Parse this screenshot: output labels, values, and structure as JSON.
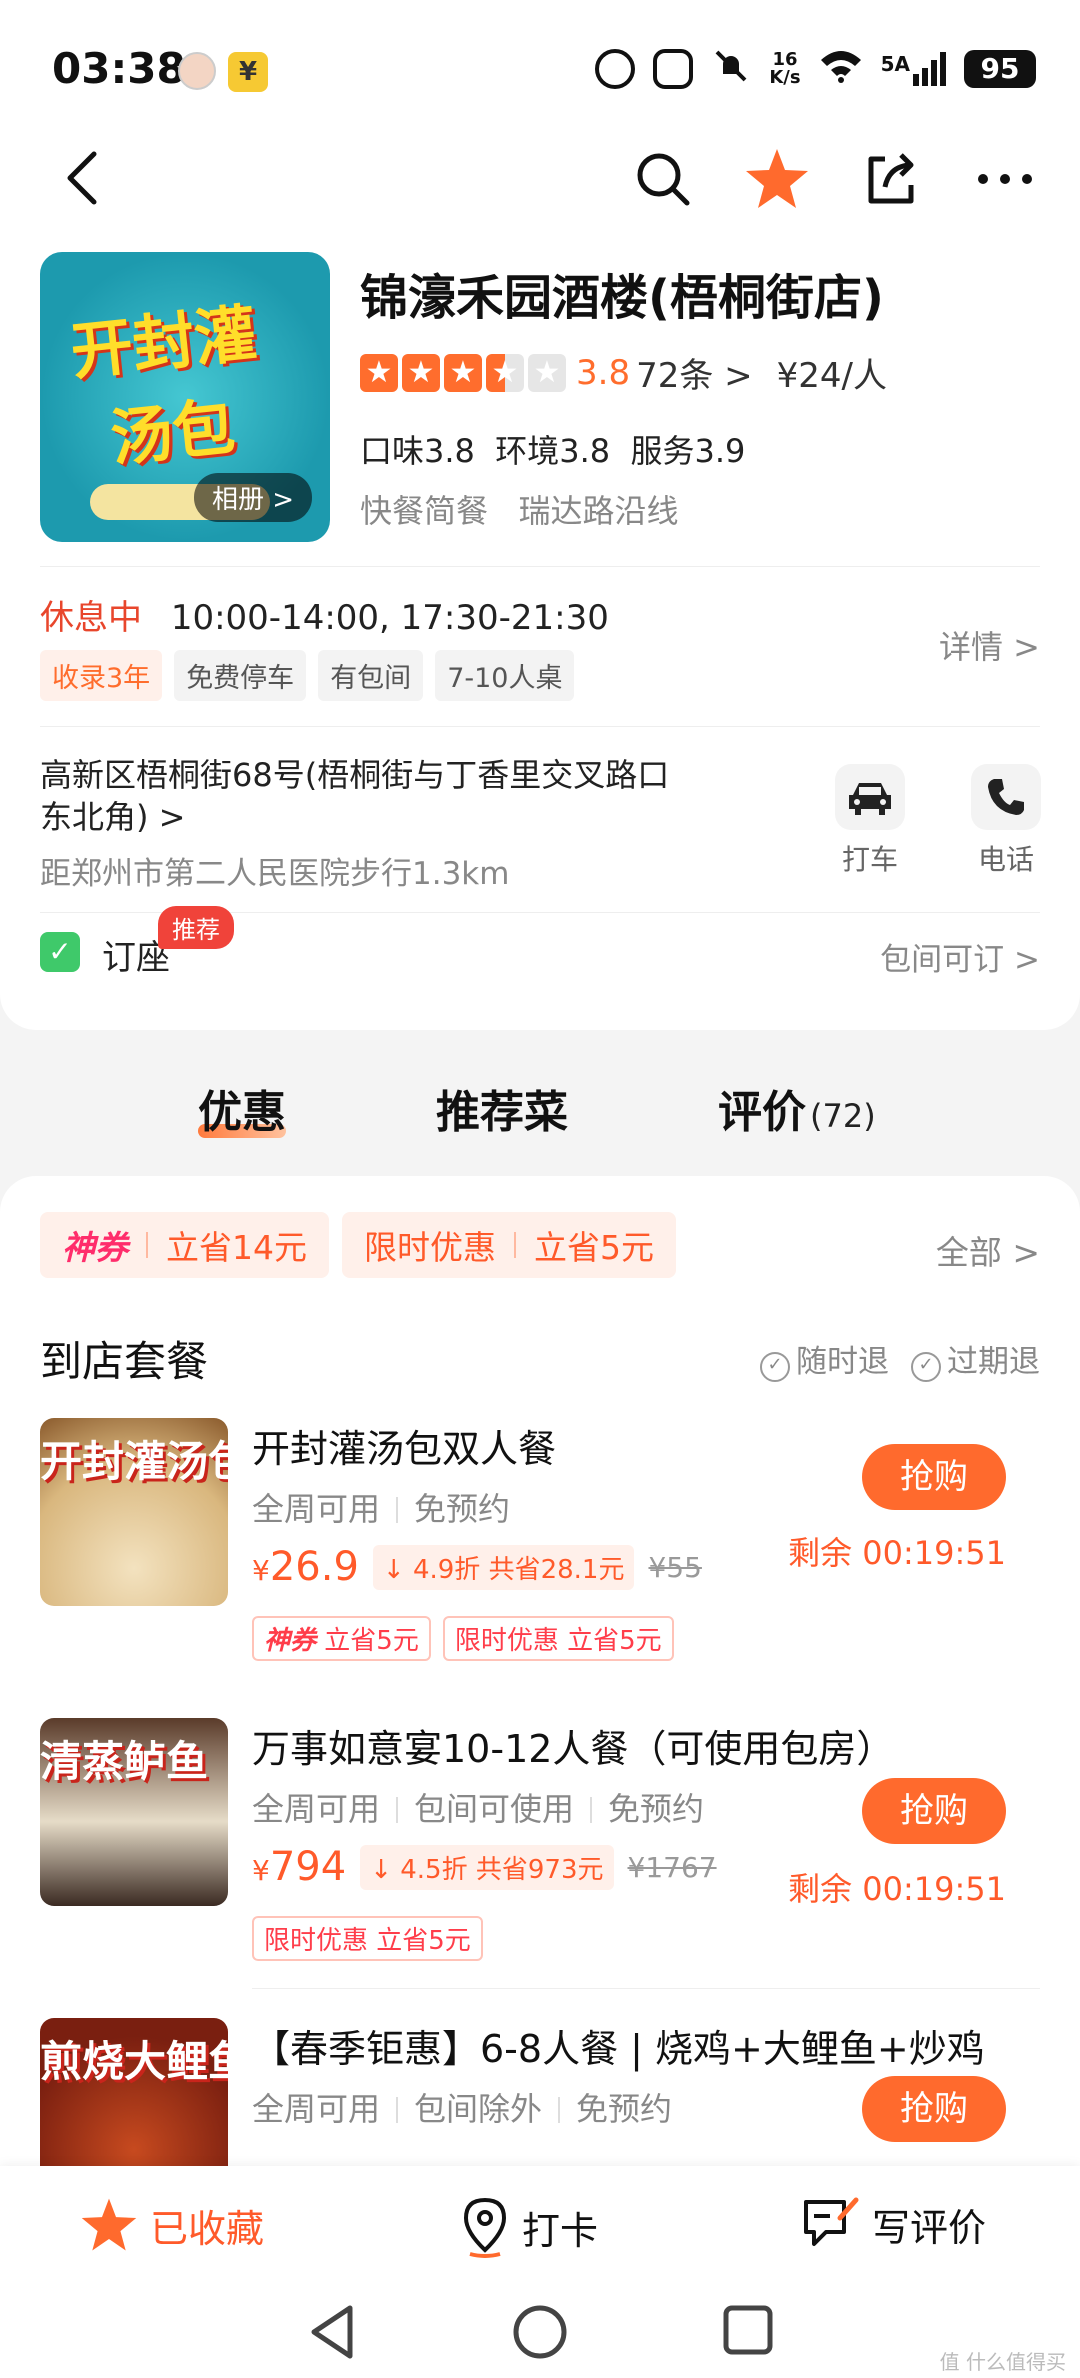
{
  "status_bar": {
    "time": "03:38",
    "yen_badge": "¥",
    "net_speed_value": "16",
    "net_speed_unit": "K/s",
    "signal_label": "5A",
    "battery": "95"
  },
  "shop": {
    "name": "锦濠禾园酒楼(梧桐街店)",
    "image_text_line1": "开封灌",
    "image_text_line2": "汤包",
    "album_label": "相册 >",
    "rating": "3.8",
    "rating_fraction": 0.76,
    "review_count": "72条 >",
    "avg_price": "¥24/人",
    "sub_scores": "口味3.8  环境3.8  服务3.9",
    "categories": "快餐简餐   瑞达路沿线",
    "status": "休息中",
    "hours": "10:00-14:00, 17:30-21:30",
    "tags": [
      "收录3年",
      "免费停车",
      "有包间",
      "7-10人桌"
    ],
    "detail_link": "详情 >",
    "address": "高新区梧桐街68号(梧桐街与丁香里交叉路口东北角) >",
    "distance": "距郑州市第二人民医院步行1.3km",
    "taxi_label": "打车",
    "phone_label": "电话",
    "booking_label": "订座",
    "booking_badge": "推荐",
    "booking_right": "包间可订 >"
  },
  "tabs": [
    {
      "label": "优惠"
    },
    {
      "label": "推荐菜"
    },
    {
      "label": "评价",
      "count": "(72)"
    }
  ],
  "coupons": {
    "pill1_label": "神券",
    "pill1_value": "立省14元",
    "pill2_label": "限时优惠",
    "pill2_value": "立省5元",
    "all_link": "全部 >"
  },
  "section": {
    "title": "到店套餐",
    "policy1": "随时退",
    "policy2": "过期退"
  },
  "deals": [
    {
      "img_text": "开封灌汤包",
      "title": "开封灌汤包双人餐",
      "meta": [
        "全周可用",
        "免预约"
      ],
      "price": "26.9",
      "discount": "4.9折 共省28.1元",
      "old_price": "¥55",
      "badge1_label": "神券",
      "badge1_value": "立省5元",
      "badge2": "限时优惠 立省5元",
      "buy": "抢购",
      "remain": "剩余 00:19:51"
    },
    {
      "img_text": "清蒸鲈鱼",
      "title": "万事如意宴10-12人餐（可使用包房）",
      "meta": [
        "全周可用",
        "包间可使用",
        "免预约"
      ],
      "price": "794",
      "discount": "4.5折 共省973元",
      "old_price": "¥1767",
      "badge2": "限时优惠 立省5元",
      "buy": "抢购",
      "remain": "剩余 00:19:51"
    },
    {
      "img_text": "煎烧大鲤鱼",
      "title": "【春季钜惠】6-8人餐 | 烧鸡+大鲤鱼+炒鸡",
      "meta": [
        "全周可用",
        "包间除外",
        "免预约"
      ],
      "buy": "抢购"
    }
  ],
  "bottom_bar": {
    "fav": "已收藏",
    "checkin": "打卡",
    "review": "写评价"
  },
  "watermark": "值 什么值得买",
  "colors": {
    "accent": "#ff6a2d",
    "status_red": "#e8462c",
    "booking_green": "#3fc96a"
  }
}
